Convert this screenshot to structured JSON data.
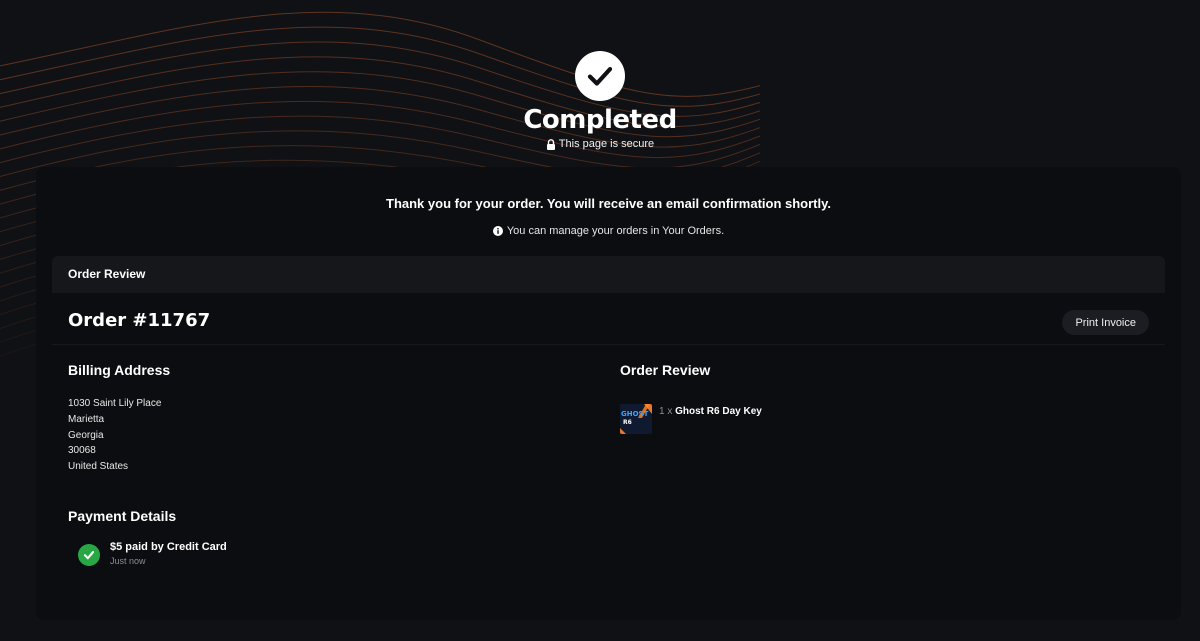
{
  "hero": {
    "title": "Completed",
    "secure_text": "This page is secure"
  },
  "messages": {
    "thank_you": "Thank you for your order. You will receive an email confirmation shortly.",
    "manage_orders": "You can manage your orders in Your Orders."
  },
  "review_bar": {
    "title": "Order Review"
  },
  "order": {
    "number": "Order #11767",
    "print_label": "Print Invoice"
  },
  "billing": {
    "title": "Billing Address",
    "lines": [
      "1030 Saint Lily Place",
      "Marietta",
      "Georgia",
      "30068",
      "United States"
    ]
  },
  "payment": {
    "title": "Payment Details",
    "summary": "$5 paid by Credit Card",
    "time": "Just now"
  },
  "order_review": {
    "title": "Order Review",
    "items": [
      {
        "qty": "1 x",
        "name": "Ghost R6 Day Key",
        "thumb_text": "GHOST",
        "thumb_sub": "R6"
      }
    ]
  },
  "colors": {
    "background": "#101114",
    "card": "#0c0d10",
    "accent_wave": "#a0522d",
    "success": "#27a844"
  },
  "icons": [
    "check-icon",
    "lock-icon",
    "info-icon",
    "success-check-icon"
  ]
}
